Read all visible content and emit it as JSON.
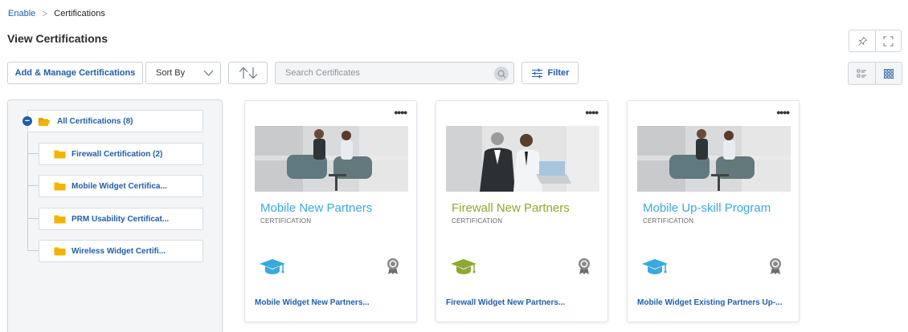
{
  "breadcrumb": {
    "root": "Enable",
    "separator": ">",
    "current": "Certifications"
  },
  "page": {
    "title": "View Certifications"
  },
  "toolbar": {
    "add_label": "Add & Manage Certifications",
    "sort_label": "Sort By",
    "search_placeholder": "Search Certificates",
    "filter_label": "Filter"
  },
  "icons": {
    "pin": "pin-icon",
    "fullscreen": "fullscreen-icon",
    "sort_chevron": "chevron-down-icon",
    "sort_order": "sort-order-arrows-icon",
    "search": "search-icon",
    "filter": "filter-sliders-icon",
    "list_view": "list-view-icon",
    "grid_view": "grid-view-icon",
    "folder": "folder-icon",
    "open_folder": "folder-open-icon",
    "collapse": "minus-circle-icon",
    "more": "more-dots-icon",
    "graduation": "graduation-cap-icon",
    "award": "award-ribbon-icon"
  },
  "tree": {
    "root": {
      "label": "All Certifications (8)",
      "expanded": true
    },
    "children": [
      {
        "label": "Firewall Certification (2)"
      },
      {
        "label": "Mobile Widget Certifica..."
      },
      {
        "label": "PRM Usability Certificat..."
      },
      {
        "label": "Wireless Widget Certifi..."
      }
    ]
  },
  "cards": [
    {
      "title": "Mobile New Partners",
      "type": "CERTIFICATION",
      "description": "Mobile Widget New Partners...",
      "accent": "#3aa9dc"
    },
    {
      "title": "Firewall New Partners",
      "type": "CERTIFICATION",
      "description": "Firewall Widget New Partners...",
      "accent": "#8fa832"
    },
    {
      "title": "Mobile Up-skill Program",
      "type": "CERTIFICATION",
      "description": "Mobile Widget Existing Partners Up-...",
      "accent": "#3aa9dc"
    }
  ],
  "colors": {
    "link": "#1f5fa8",
    "folder": "#f5b301",
    "blue_accent": "#3aa9dc",
    "green_accent": "#8fa832"
  }
}
